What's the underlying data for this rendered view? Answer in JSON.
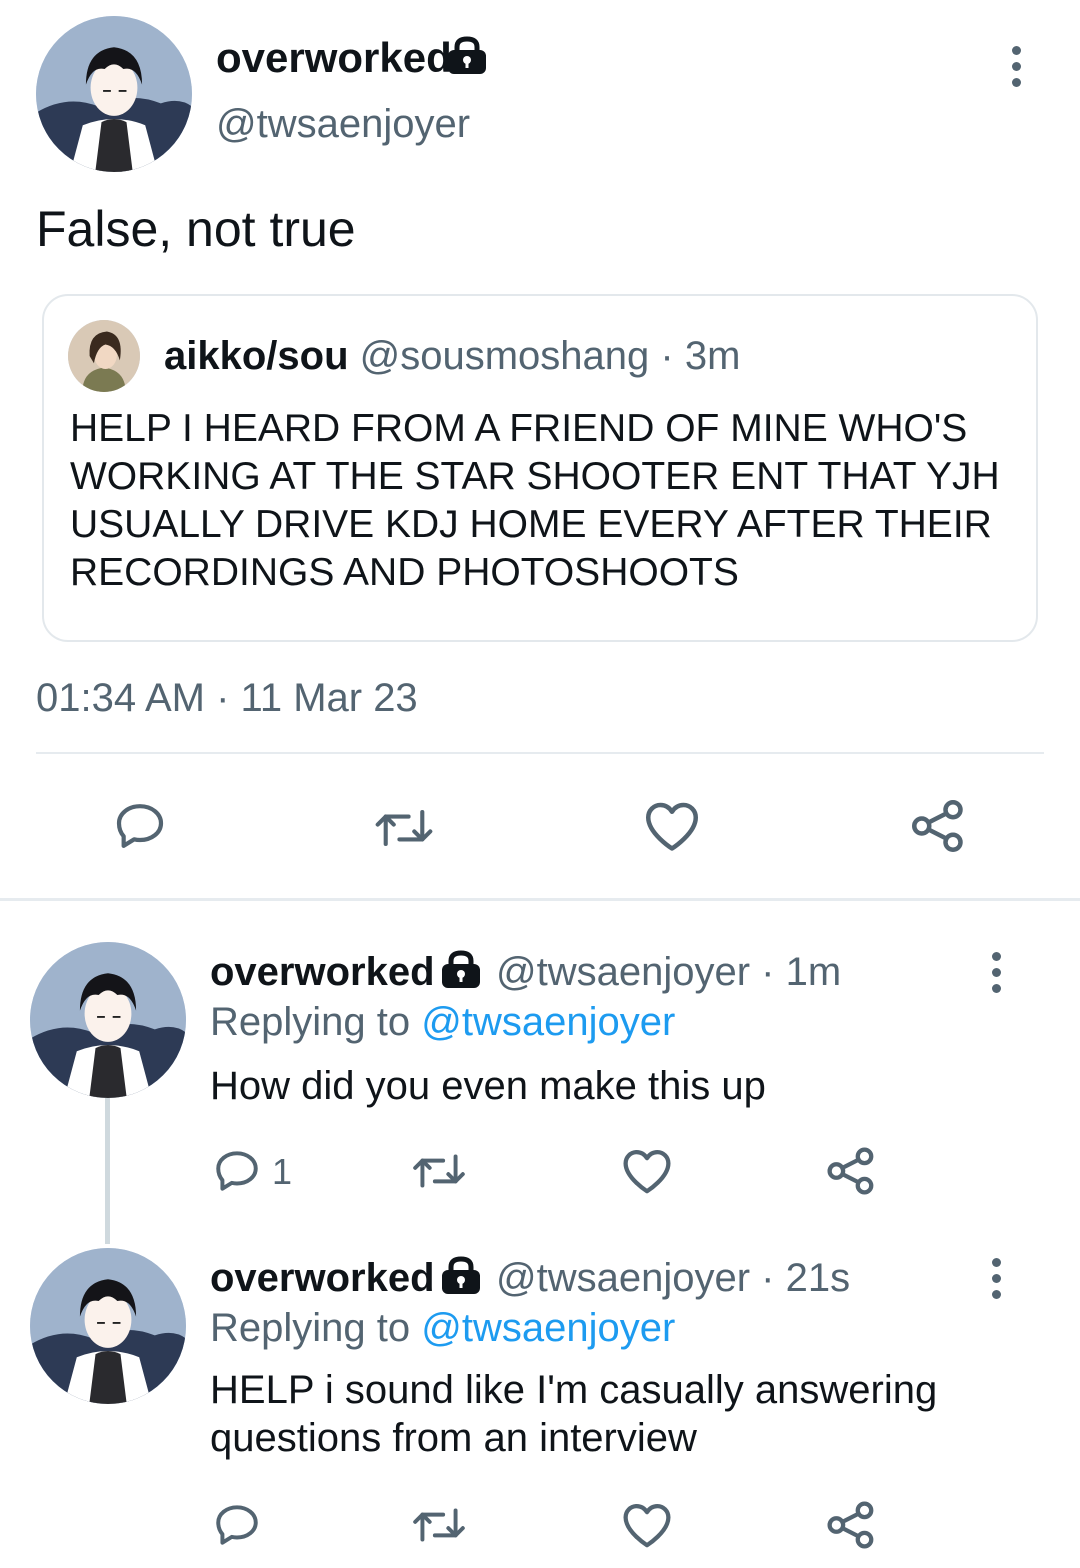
{
  "main_tweet": {
    "display_name": "overworked",
    "handle": "@twsaenjoyer",
    "text": "False, not true",
    "quoted": {
      "display_name": "aikko/sou",
      "handle": "@sousmoshang",
      "sep": "·",
      "time": "3m",
      "text": "HELP I HEARD FROM A FRIEND OF MINE WHO'S WORKING AT THE STAR SHOOTER ENT THAT YJH USUALLY DRIVE KDJ HOME EVERY AFTER THEIR RECORDINGS AND PHOTOSHOOTS"
    },
    "timestamp": "01:34 AM · 11 Mar 23"
  },
  "replies": [
    {
      "display_name": "overworked",
      "handle": "@twsaenjoyer",
      "time": "· 1m",
      "replying_prefix": "Replying to",
      "replying_handle": "@twsaenjoyer",
      "text": "How did you even make this up",
      "reply_count": "1"
    },
    {
      "display_name": "overworked",
      "handle": "@twsaenjoyer",
      "time": "· 21s",
      "replying_prefix": "Replying to",
      "replying_handle": "@twsaenjoyer",
      "text": "HELP i sound like I'm casually answering questions from an interview",
      "reply_count": ""
    }
  ],
  "icons": {
    "lock": "lock-icon",
    "more": "more-vertical-icon",
    "reply": "reply-icon",
    "retweet": "retweet-icon",
    "like": "heart-icon",
    "share": "share-icon"
  },
  "colors": {
    "text": "#0f1419",
    "muted": "#536471",
    "link": "#1d9bf0",
    "border": "#e3e8ec"
  }
}
